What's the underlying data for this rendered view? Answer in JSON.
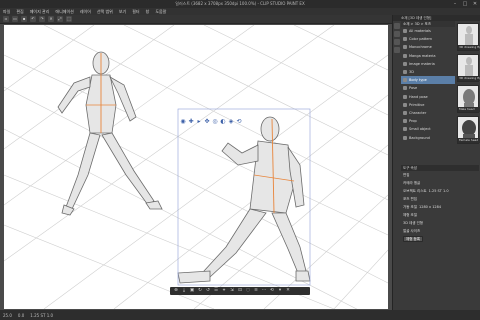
{
  "window": {
    "title": "일러스트 (3682 x 3708px 350dpi 100.0%) - CLIP STUDIO PAINT EX",
    "minimize": "–",
    "maximize": "□",
    "close": "✕"
  },
  "menu": [
    "파일",
    "편집",
    "페이지 관리",
    "애니메이션",
    "레이어",
    "선택 범위",
    "보기",
    "필터",
    "창",
    "도움말"
  ],
  "toolbar_icons": [
    "new-icon",
    "open-icon",
    "save-icon",
    "undo-icon",
    "redo-icon",
    "erase-icon",
    "transform-icon",
    "deselect-icon"
  ],
  "panel": {
    "title": "소재 [3D 데생 인형]",
    "path": "소재 > 3D > 포즈",
    "tree": [
      {
        "label": "All materials",
        "selected": false
      },
      {
        "label": "Color pattern",
        "selected": false
      },
      {
        "label": "Monochrome",
        "selected": false
      },
      {
        "label": "Manga materia",
        "selected": false
      },
      {
        "label": "Image materia",
        "selected": false
      },
      {
        "label": "3D",
        "selected": false
      },
      {
        "label": "Body type",
        "selected": true
      },
      {
        "label": "Pose",
        "selected": false
      },
      {
        "label": "Hand pose",
        "selected": false
      },
      {
        "label": "Primitive",
        "selected": false
      },
      {
        "label": "Character",
        "selected": false
      },
      {
        "label": "Prop",
        "selected": false
      },
      {
        "label": "Small object",
        "selected": false
      },
      {
        "label": "Background",
        "selected": false
      }
    ],
    "thumbs": [
      "3D drawing figure",
      "3D drawing figure",
      "Male head",
      "Female head"
    ],
    "props_title": "도구 속성",
    "prop_rows": [
      "편집",
      "카메라 앵글",
      "오브젝트 리스트",
      "포즈 편집",
      "가동 조절",
      "체형 조절",
      "3D 데생 인형",
      "얼굴 사이즈"
    ],
    "prop_values": [
      "1.25 ST 1.0",
      "1280 x 1284"
    ],
    "prop_button": "체형 등록"
  },
  "status": {
    "zoom": "25.0",
    "angle": "0.0",
    "info": "1.25 ST 1.0"
  },
  "float_toolbar_top": [
    "camera-icon",
    "move-icon",
    "pan-icon",
    "rotate-icon",
    "zoom-icon",
    "light-icon",
    "settings-icon",
    "reset-icon"
  ],
  "float_toolbar_bottom": [
    "pose-icon",
    "move-ground-icon",
    "fit-icon",
    "rotate-x-icon",
    "rotate-y-icon",
    "preset-icon",
    "position-icon",
    "scale-icon",
    "lock-icon",
    "hide-icon",
    "menu-icon",
    "more-icon",
    "reset-icon",
    "delete-icon",
    "close-icon"
  ]
}
